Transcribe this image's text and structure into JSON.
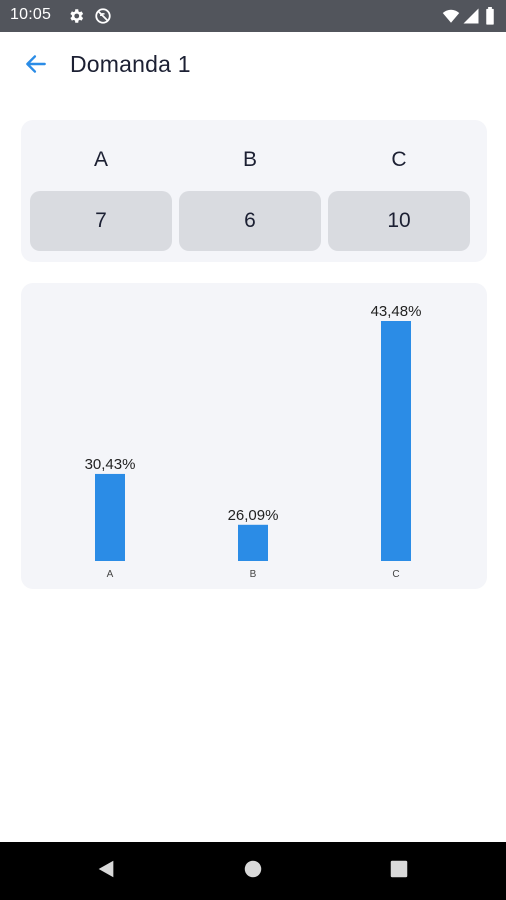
{
  "status_bar": {
    "time": "10:05",
    "icons": [
      "settings-icon",
      "sync-disabled-icon",
      "wifi-icon",
      "signal-icon",
      "battery-icon"
    ]
  },
  "app_bar": {
    "back_icon": "arrow-left-icon",
    "title": "Domanda 1"
  },
  "counts": [
    {
      "label": "A",
      "value": "7"
    },
    {
      "label": "B",
      "value": "6"
    },
    {
      "label": "C",
      "value": "10"
    }
  ],
  "chart_data": {
    "type": "bar",
    "categories": [
      "A",
      "B",
      "C"
    ],
    "values": [
      30.43,
      26.09,
      43.48
    ],
    "data_labels": [
      "30,43%",
      "26,09%",
      "43,48%"
    ],
    "ylim": [
      23,
      43.48
    ],
    "grid": false,
    "bar_color": "#2b8ce6"
  },
  "colors": {
    "accent": "#2b8ce6",
    "card_bg": "#f4f5f9",
    "count_box_bg": "#d9dbe0"
  },
  "nav_bar": {
    "icons": [
      "back-triangle-icon",
      "home-circle-icon",
      "recents-square-icon"
    ]
  }
}
